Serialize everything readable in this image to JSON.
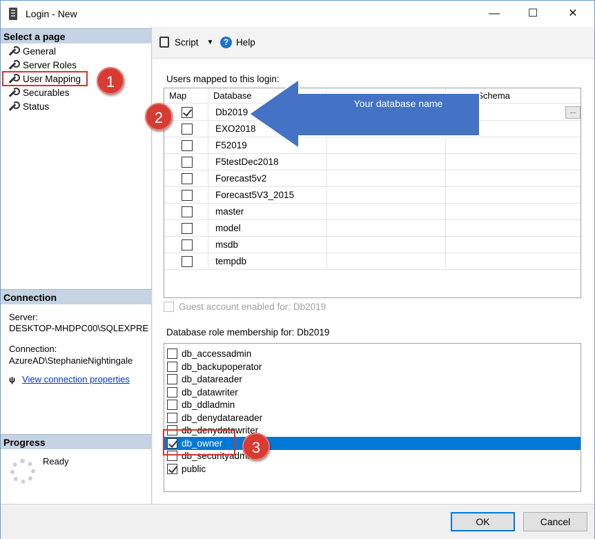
{
  "window": {
    "title": "Login - New",
    "controls": {
      "minimize": "—",
      "maximize": "☐",
      "close": "✕"
    }
  },
  "left_panel": {
    "select_page_header": "Select a page",
    "pages": [
      {
        "label": "General"
      },
      {
        "label": "Server Roles"
      },
      {
        "label": "User Mapping"
      },
      {
        "label": "Securables"
      },
      {
        "label": "Status"
      }
    ],
    "connection_header": "Connection",
    "server_label": "Server:",
    "server_value": "DESKTOP-MHDPC00\\SQLEXPRE",
    "connection_label": "Connection:",
    "connection_value": "AzureAD\\StephanieNightingale",
    "view_connection_link": "View connection properties",
    "progress_header": "Progress",
    "progress_status": "Ready"
  },
  "toolbar": {
    "script_label": "Script",
    "help_label": "Help"
  },
  "users_mapped": {
    "label": "Users mapped to this login:",
    "columns": [
      "Map",
      "Database",
      "User",
      "Default Schema"
    ],
    "visible_column_header_partial": "t Schema",
    "rows": [
      {
        "map": true,
        "database": "Db2019"
      },
      {
        "map": false,
        "database": "EXO2018"
      },
      {
        "map": false,
        "database": "F52019"
      },
      {
        "map": false,
        "database": "F5testDec2018"
      },
      {
        "map": false,
        "database": "Forecast5v2"
      },
      {
        "map": false,
        "database": "Forecast5V3_2015"
      },
      {
        "map": false,
        "database": "master"
      },
      {
        "map": false,
        "database": "model"
      },
      {
        "map": false,
        "database": "msdb"
      },
      {
        "map": false,
        "database": "tempdb"
      }
    ],
    "ellipsis_button": "..."
  },
  "guest_account_label": "Guest account enabled for: Db2019",
  "role_membership": {
    "label": "Database role membership for: Db2019",
    "roles": [
      {
        "name": "db_accessadmin",
        "checked": false,
        "selected": false
      },
      {
        "name": "db_backupoperator",
        "checked": false,
        "selected": false
      },
      {
        "name": "db_datareader",
        "checked": false,
        "selected": false
      },
      {
        "name": "db_datawriter",
        "checked": false,
        "selected": false
      },
      {
        "name": "db_ddladmin",
        "checked": false,
        "selected": false
      },
      {
        "name": "db_denydatareader",
        "checked": false,
        "selected": false
      },
      {
        "name": "db_denydatawriter",
        "checked": false,
        "selected": false
      },
      {
        "name": "db_owner",
        "checked": true,
        "selected": true
      },
      {
        "name": "db_securityadmin",
        "checked": false,
        "selected": false
      },
      {
        "name": "public",
        "checked": true,
        "selected": false
      }
    ]
  },
  "annotations": {
    "badge_1": "1",
    "badge_2": "2",
    "badge_3": "3",
    "arrow_text": "Your database name",
    "arrow_color": "#4472c4",
    "badge_color": "#d73b33"
  },
  "buttons": {
    "ok": "OK",
    "cancel": "Cancel"
  }
}
